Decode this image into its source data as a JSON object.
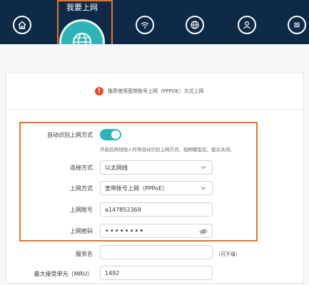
{
  "nav": {
    "active_label": "我要上网",
    "icons": [
      "home-icon",
      "globe-icon",
      "wifi-icon",
      "network-settings-icon",
      "user-icon",
      "more-menu-icon"
    ]
  },
  "notice": {
    "text": "推荐使用宽带账号上网（PPPOE）方式上网"
  },
  "form": {
    "auto_detect_label": "自动识别上网方式",
    "auto_detect_on": true,
    "auto_detect_hint": "开启后网线插入时将自动识别上网方式，组网模型后，建议关闭。",
    "connection_type_label": "连接方式",
    "connection_type_value": "以太网线",
    "internet_mode_label": "上网方式",
    "internet_mode_value": "宽带账号上网（PPPoE）",
    "account_label": "上网账号",
    "account_value": "a147852369",
    "password_label": "上网密码",
    "password_value": "••••••••",
    "service_name_label": "服务名",
    "service_name_value": "",
    "service_name_note": "（可不填）",
    "mru_label": "最大接受单元（MRU）",
    "mru_value": "1492"
  },
  "colors": {
    "topbar": "#0e2a47",
    "accent": "#2fb3b6",
    "highlight": "#e8742b",
    "warning": "#e64a2e"
  }
}
